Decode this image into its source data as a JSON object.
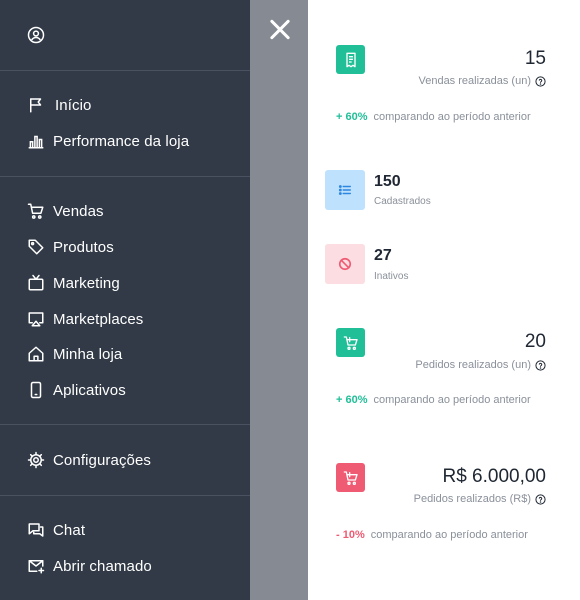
{
  "sidebar": {
    "items": [
      {
        "id": "inicio",
        "label": "Início"
      },
      {
        "id": "performance",
        "label": "Performance da loja"
      },
      {
        "id": "vendas",
        "label": "Vendas"
      },
      {
        "id": "produtos",
        "label": "Produtos"
      },
      {
        "id": "marketing",
        "label": "Marketing"
      },
      {
        "id": "marketplaces",
        "label": "Marketplaces"
      },
      {
        "id": "minha-loja",
        "label": "Minha loja"
      },
      {
        "id": "aplicativos",
        "label": "Aplicativos"
      },
      {
        "id": "configuracoes",
        "label": "Configurações"
      },
      {
        "id": "chat",
        "label": "Chat"
      },
      {
        "id": "abrir-chamado",
        "label": "Abrir chamado"
      }
    ]
  },
  "stats": {
    "vendas": {
      "value": "15",
      "caption": "Vendas realizadas (un)",
      "delta": "+ 60%",
      "delta_text": "comparando ao período anterior"
    },
    "cadastrados": {
      "value": "150",
      "label": "Cadastrados"
    },
    "inativos": {
      "value": "27",
      "label": "Inativos"
    },
    "pedidos_un": {
      "value": "20",
      "caption": "Pedidos realizados (un)",
      "delta": "+ 60%",
      "delta_text": "comparando ao período anterior"
    },
    "pedidos_rs": {
      "value": "R$ 6.000,00",
      "caption": "Pedidos realizados (R$)",
      "delta": "- 10%",
      "delta_text": "comparando ao período anterior"
    }
  },
  "colors": {
    "sidebar_bg": "#323a47",
    "overlay": "#868b93",
    "green": "#20bf98",
    "red": "#ef5b73",
    "blue_badge": "#bee1fd",
    "pink_badge": "#fcdde2"
  }
}
